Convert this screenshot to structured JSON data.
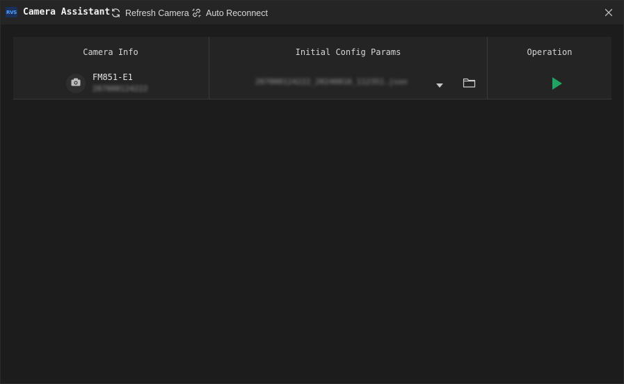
{
  "app": {
    "logo_text": "RVS",
    "title": "Camera Assistant"
  },
  "toolbar": {
    "refresh_label": "Refresh Camera",
    "reconnect_label": "Auto Reconnect"
  },
  "table": {
    "headers": {
      "camera_info": "Camera Info",
      "config_params": "Initial Config Params",
      "operation": "Operation"
    },
    "rows": [
      {
        "model": "FM851-E1",
        "serial": "207000124222",
        "config_file": "207000124222_20240816_112351.json"
      }
    ]
  },
  "icons": {
    "refresh": "refresh-icon",
    "reconnect": "reconnect-icon",
    "close": "close-icon",
    "camera": "camera-icon",
    "dropdown": "chevron-down-icon",
    "folder": "folder-icon",
    "play": "play-icon"
  },
  "colors": {
    "background": "#1c1c1c",
    "titlebar": "#252525",
    "panel": "#242424",
    "play_accent": "#21a366",
    "logo_accent": "#4fa3ff"
  }
}
